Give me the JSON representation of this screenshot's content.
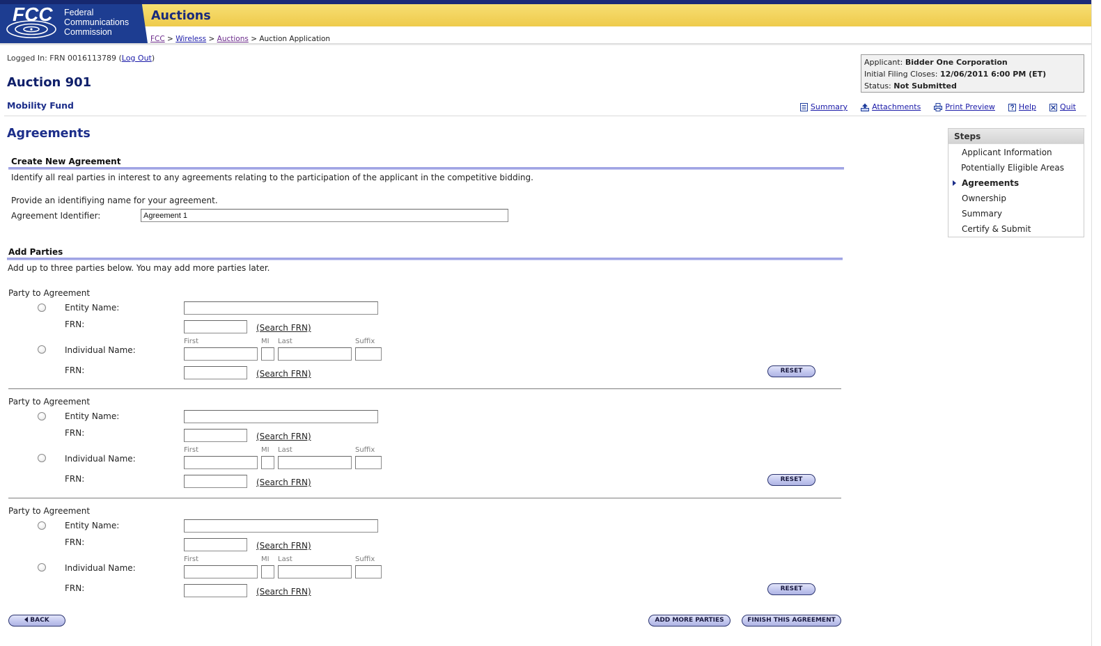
{
  "colors": {
    "navy": "#1b2a78",
    "logo_blue": "#1d3d91",
    "yellow": "#f3d45f",
    "heading": "#1c2e8a",
    "link": "#1a1aa8",
    "section_bar": "#a0a4e4",
    "button_fill": "#c3c8ef"
  },
  "header": {
    "logo": {
      "abbr": "FCC",
      "line1": "Federal",
      "line2": "Communications",
      "line3": "Commission"
    },
    "title": "Auctions",
    "breadcrumb_sep": ">",
    "breadcrumb": [
      {
        "label": "FCC"
      },
      {
        "label": "Wireless"
      },
      {
        "label": "Auctions"
      },
      {
        "label": "Auction Application"
      }
    ]
  },
  "session": {
    "prefix": "Logged In: FRN 0016113789 (",
    "logout": "Log Out",
    "suffix": ")"
  },
  "applicant_box": {
    "applicant_label": "Applicant:",
    "applicant_value": "Bidder One Corporation",
    "closes_label": "Initial Filing Closes:",
    "closes_value": "12/06/2011 6:00 PM (ET)",
    "status_label": "Status:",
    "status_value": "Not Submitted"
  },
  "auction": {
    "title": "Auction 901",
    "subtitle": "Mobility Fund"
  },
  "toolbar": [
    {
      "label": "Summary",
      "icon": "summary-icon"
    },
    {
      "label": "Attachments",
      "icon": "attachments-icon"
    },
    {
      "label": "Print Preview",
      "icon": "print-icon"
    },
    {
      "label": "Help",
      "icon": "help-icon"
    },
    {
      "label": "Quit",
      "icon": "quit-icon"
    }
  ],
  "page_title": "Agreements",
  "steps": {
    "title": "Steps",
    "current": "Agreements",
    "items": [
      {
        "label": "Applicant Information"
      },
      {
        "label": "Potentially Eligible Areas"
      },
      {
        "label": "Agreements"
      },
      {
        "label": "Ownership"
      },
      {
        "label": "Summary"
      },
      {
        "label": "Certify & Submit"
      }
    ]
  },
  "create_agreement": {
    "heading": "Create New Agreement",
    "instructions": "Identify all real parties in interest to any agreements relating to the participation of the applicant in the competitive bidding.",
    "name_prompt": "Provide an identifiying name for your agreement.",
    "identifier_label": "Agreement Identifier:",
    "identifier_value": "Agreement 1"
  },
  "add_parties": {
    "heading": "Add Parties",
    "instructions": "Add up to three parties below. You may add more parties later."
  },
  "party_form": {
    "title": "Party to Agreement",
    "entity_label": "Entity Name:",
    "frn_label": "FRN:",
    "search_frn": "(Search FRN)",
    "individual_label": "Individual Name:",
    "first": "First",
    "mi": "MI",
    "last": "Last",
    "suffix": "Suffix",
    "reset": "RESET"
  },
  "parties": [
    {
      "entity_name": "",
      "entity_frn": "",
      "first": "",
      "mi": "",
      "last": "",
      "suffix": "",
      "individual_frn": ""
    },
    {
      "entity_name": "",
      "entity_frn": "",
      "first": "",
      "mi": "",
      "last": "",
      "suffix": "",
      "individual_frn": ""
    },
    {
      "entity_name": "",
      "entity_frn": "",
      "first": "",
      "mi": "",
      "last": "",
      "suffix": "",
      "individual_frn": ""
    }
  ],
  "buttons": {
    "back": "BACK",
    "add_more": "ADD MORE PARTIES",
    "finish": "FINISH THIS AGREEMENT"
  }
}
